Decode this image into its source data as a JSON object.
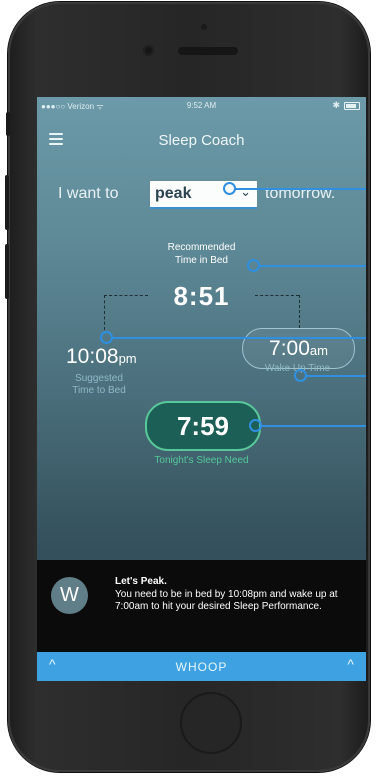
{
  "status_bar": {
    "carrier": "●●●○○ Verizon ᯤ",
    "time": "9:52 AM",
    "bluetooth": "✱"
  },
  "header": {
    "title": "Sleep Coach",
    "menu_icon": "hamburger-menu-icon"
  },
  "goal": {
    "prefix": "I want to",
    "selected": "peak",
    "suffix": "tomorrow."
  },
  "recommended": {
    "label_line1": "Recommended",
    "label_line2": "Time in Bed",
    "value": "8:51"
  },
  "bedtime": {
    "value": "10:08",
    "suffix": "pm",
    "caption_line1": "Suggested",
    "caption_line2": "Time to Bed"
  },
  "wake": {
    "value": "7:00",
    "suffix": "am",
    "caption": "Wake Up Time"
  },
  "sleep_need": {
    "value": "7:59",
    "caption": "Tonight's Sleep Need"
  },
  "coach_message": {
    "logo": "W",
    "heading": "Let's Peak.",
    "body": "You need to be in bed by 10:08pm and wake up at 7:00am to hit your desired Sleep Performance."
  },
  "bottom_bar": {
    "label": "WHOOP",
    "left_icon": "^",
    "right_icon": "^"
  },
  "colors": {
    "accent": "#3ea2e2",
    "need": "#59c79a",
    "pointer": "#2f8fe0"
  }
}
